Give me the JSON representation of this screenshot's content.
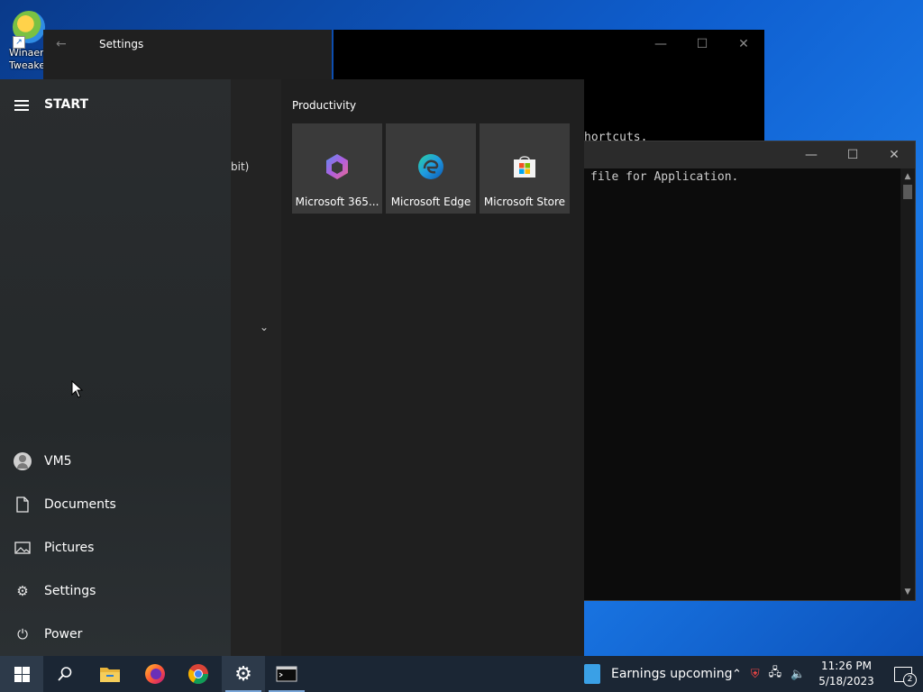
{
  "desktop": {
    "icons": [
      {
        "label": "Winaero Tweaker",
        "icon": "winaero-tweaker-icon"
      }
    ]
  },
  "settings_window": {
    "title": "Settings",
    "back_icon": "back-arrow-icon"
  },
  "console_window": {
    "visible_text": "hortcuts.",
    "controls": [
      "minimize-icon",
      "maximize-icon",
      "close-icon"
    ]
  },
  "editor_window": {
    "content": "file for Application.",
    "controls": [
      "minimize-icon",
      "maximize-icon",
      "close-icon"
    ]
  },
  "start_menu": {
    "header": "START",
    "peek_text": "bit)",
    "rail_items": [
      {
        "label": "VM5",
        "icon": "user-avatar-icon"
      },
      {
        "label": "Documents",
        "icon": "document-icon"
      },
      {
        "label": "Pictures",
        "icon": "pictures-icon"
      },
      {
        "label": "Settings",
        "icon": "gear-icon"
      },
      {
        "label": "Power",
        "icon": "power-icon"
      }
    ],
    "group": {
      "title": "Productivity",
      "tiles": [
        {
          "label": "Microsoft 365...",
          "icon": "microsoft-365-icon"
        },
        {
          "label": "Microsoft Edge",
          "icon": "edge-icon"
        },
        {
          "label": "Microsoft Store",
          "icon": "store-icon"
        }
      ]
    }
  },
  "taskbar": {
    "pinned": [
      {
        "name": "start",
        "icon": "windows-logo-icon"
      },
      {
        "name": "search",
        "icon": "search-icon"
      },
      {
        "name": "file-explorer",
        "icon": "folder-icon"
      },
      {
        "name": "firefox",
        "icon": "firefox-icon"
      },
      {
        "name": "chrome",
        "icon": "chrome-icon"
      },
      {
        "name": "settings",
        "icon": "gear-icon"
      },
      {
        "name": "terminal",
        "icon": "terminal-icon"
      }
    ],
    "news_text": "Earnings upcoming",
    "time": "11:26 PM",
    "date": "5/18/2023",
    "notification_count": "2"
  },
  "colors": {
    "taskbar": "#1b2634",
    "start_bg": "#1f1f1f",
    "tile_bg": "#3a3a3a",
    "desktop_blue": "#0f5fd0"
  }
}
